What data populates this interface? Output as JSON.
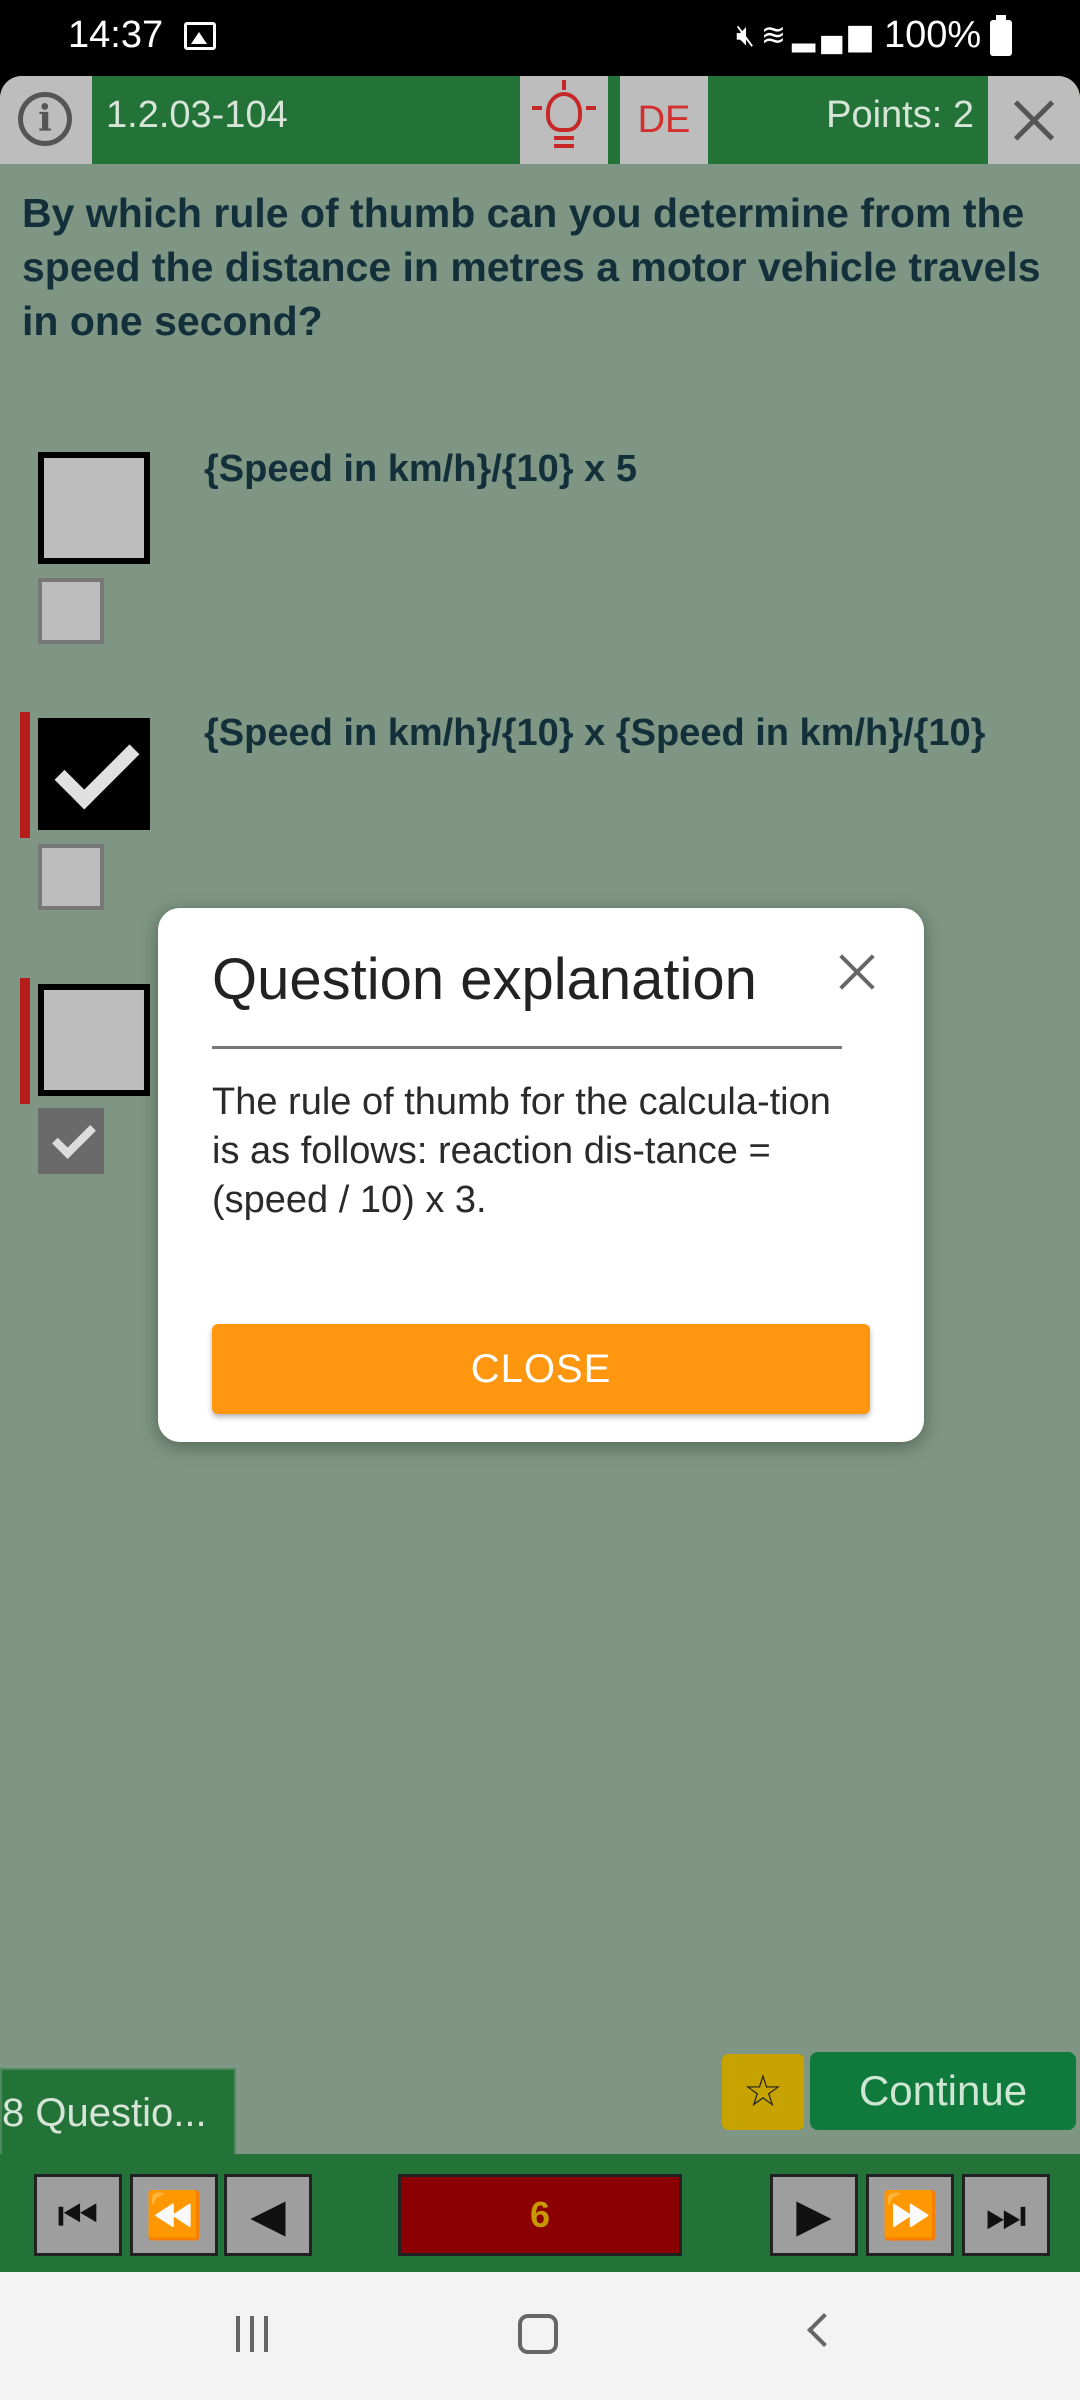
{
  "status_bar": {
    "time": "14:37",
    "battery": "100%",
    "icons": [
      "gallery-icon",
      "mute-icon",
      "wifi-icon",
      "signal-icon",
      "battery-icon"
    ]
  },
  "header": {
    "question_id": "1.2.03-104",
    "language": "DE",
    "points": "Points: 2"
  },
  "question": {
    "text": "By which rule of thumb can you determine from the speed the distance in metres a motor vehicle travels in one second?"
  },
  "answers": [
    {
      "text": "{Speed in km/h}/{10} x 5",
      "user_checked": false,
      "solution_checked": false,
      "marked": false
    },
    {
      "text": "{Speed in km/h}/{10} x {Speed in km/h}/{10}",
      "user_checked": true,
      "solution_checked": false,
      "marked": true
    },
    {
      "text": "",
      "user_checked": false,
      "solution_checked": true,
      "marked": true
    }
  ],
  "footer": {
    "question_count": "8 Questio...",
    "continue_label": "Continue",
    "page_number": "6"
  },
  "dialog": {
    "title": "Question explanation",
    "body": "The rule of thumb for the calcula-tion is as follows: reaction dis-tance = (speed / 10) x 3.",
    "close_label": "CLOSE"
  },
  "colors": {
    "primary_green": "#237238",
    "background": "#7e9683",
    "accent_orange": "#ff9610",
    "error_red": "#b71c1c",
    "star_yellow": "#c7a300"
  }
}
